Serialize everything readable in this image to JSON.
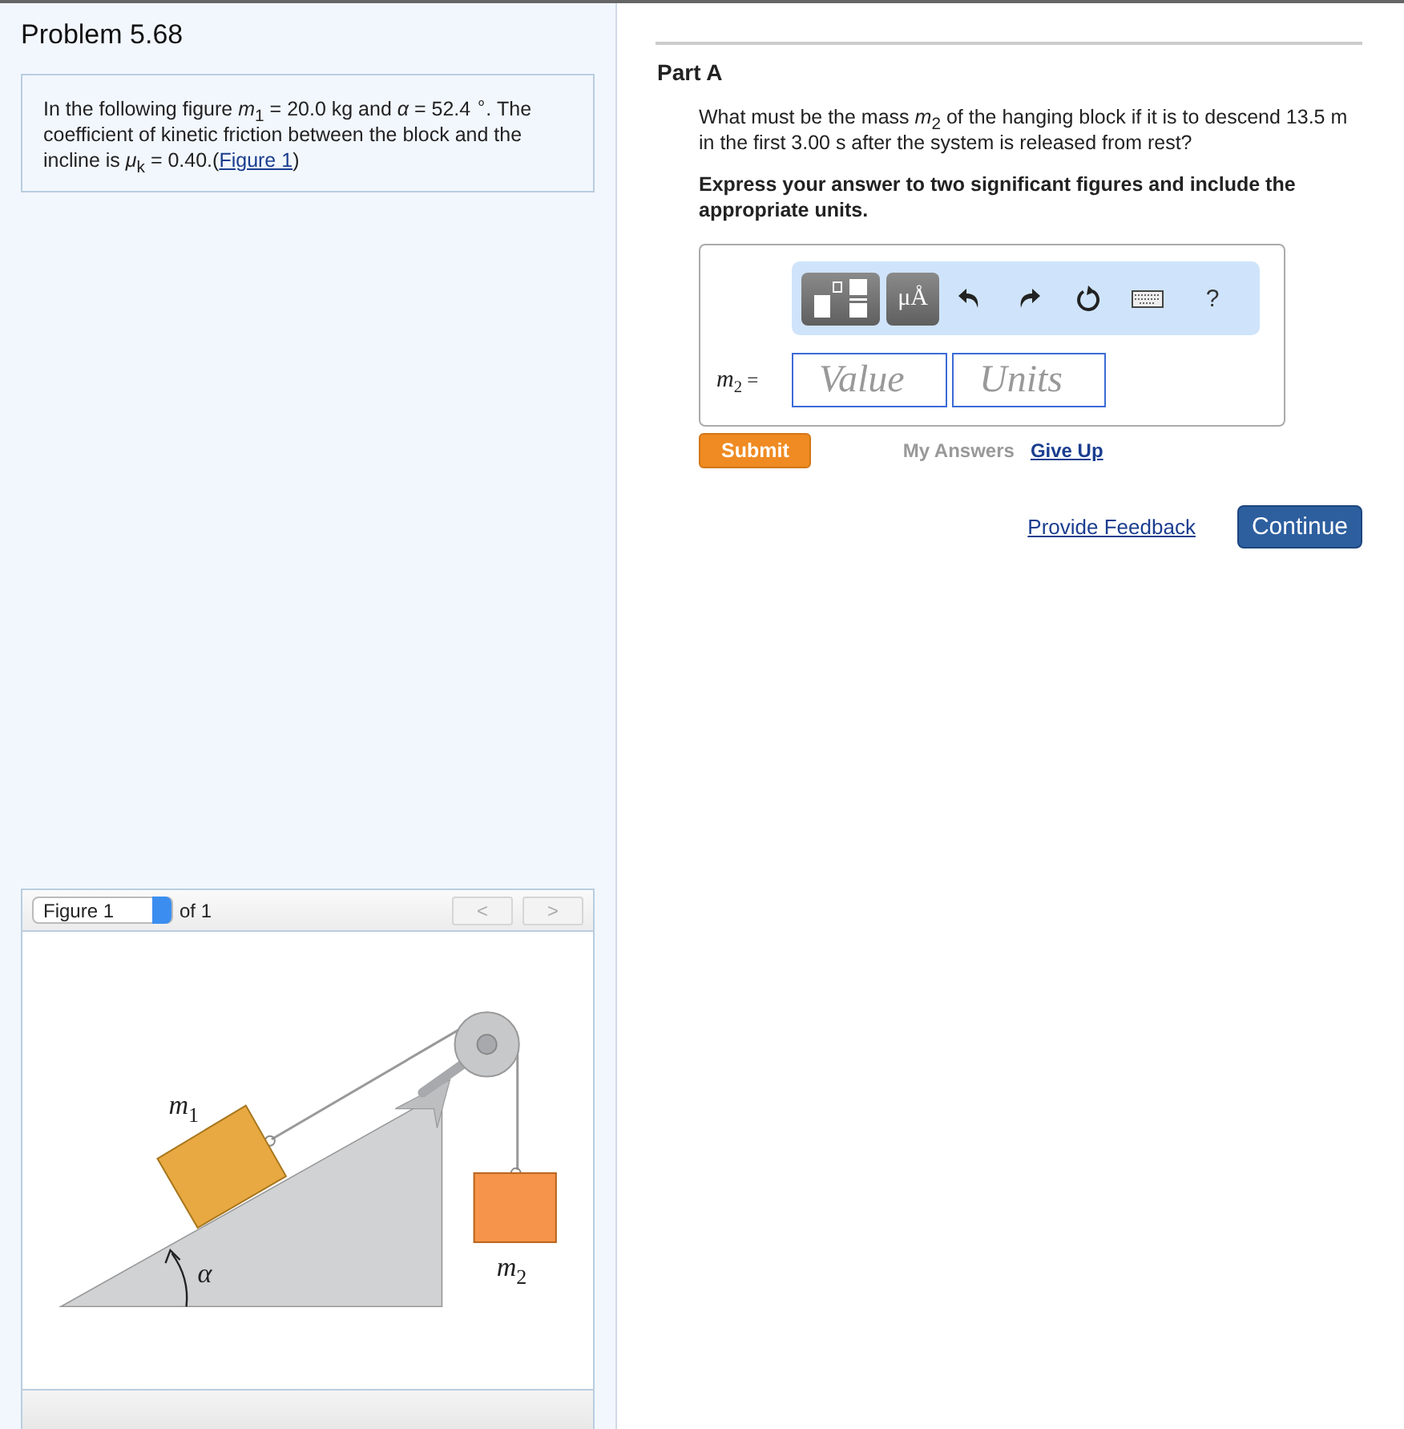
{
  "problem": {
    "title": "Problem 5.68",
    "text": "In the following figure *m*$_{1}$ = 20.0 kg and *α* = 52.4 $^{∘}$. The coefficient of kinetic friction between the block and the incline is *μ*$_{k}$ = 0.40.(",
    "figure_link": "Figure 1",
    "text_after": ")"
  },
  "figure": {
    "selector": "Figure 1",
    "count_label": "of 1",
    "prev": "<",
    "next": ">",
    "labels": [
      {
        "kind": "m1",
        "text": "m",
        "sub": "1"
      },
      {
        "kind": "alpha",
        "text": "α"
      },
      {
        "kind": "m2",
        "text": "m",
        "sub": "2"
      }
    ]
  },
  "part": {
    "title": "Part A",
    "question": "What must be the mass *m*$_{2}$ of the hanging block if it is to descend 13.5 m in the first 3.00 s after the system is released from rest?",
    "instruction": "Express your answer to two significant figures and include the appropriate units.",
    "toolbar": [
      {
        "kind": "templates"
      },
      {
        "kind": "units",
        "label": "μÅ"
      },
      {
        "kind": "undo"
      },
      {
        "kind": "redo"
      },
      {
        "kind": "reset"
      },
      {
        "kind": "keyboard"
      },
      {
        "kind": "help",
        "label": "?"
      }
    ],
    "variable": "*m*$_{2}$ =",
    "value_placeholder": "Value",
    "units_placeholder": "Units",
    "submit": "Submit",
    "my_answers": "My Answers",
    "give_up": "Give Up"
  },
  "feedback": "Provide Feedback",
  "continue": "Continue"
}
